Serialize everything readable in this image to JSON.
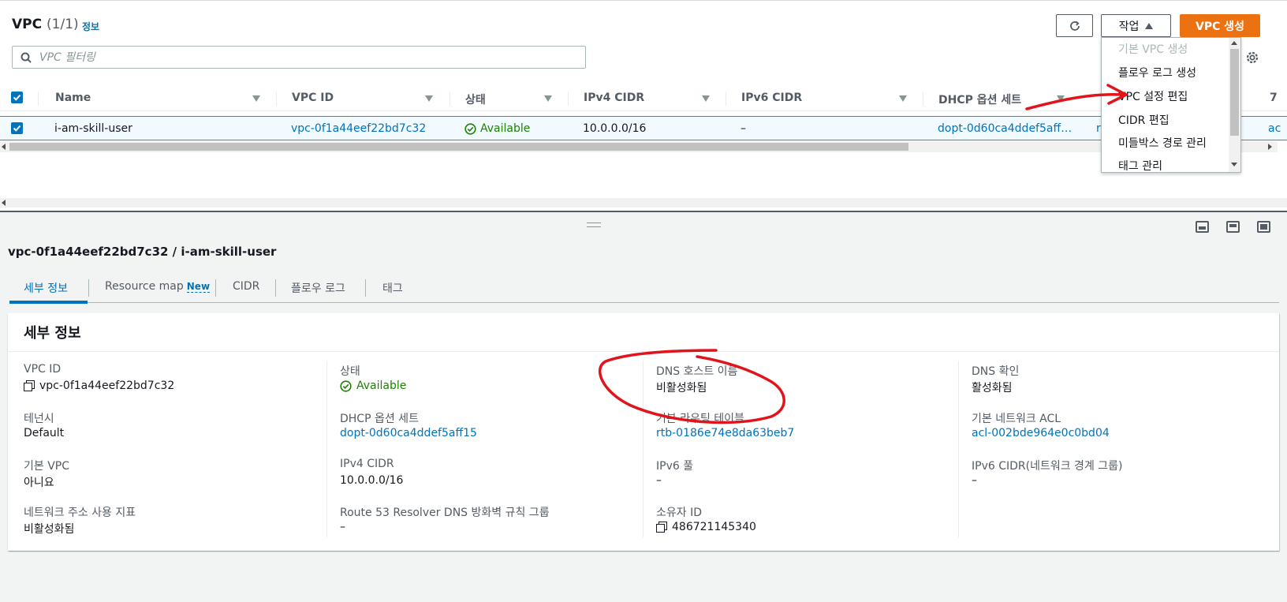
{
  "header": {
    "title": "VPC",
    "count": "(1/1)",
    "info_link": "정보",
    "actions_label": "작업",
    "create_label": "VPC 생성"
  },
  "search": {
    "placeholder": "VPC 필터링"
  },
  "table": {
    "columns": [
      "Name",
      "VPC ID",
      "상태",
      "IPv4 CIDR",
      "IPv6 CIDR",
      "DHCP 옵션 세트"
    ],
    "rows": [
      {
        "name": "i-am-skill-user",
        "vpc_id": "vpc-0f1a44eef22bd7c32",
        "status": "Available",
        "ipv4": "10.0.0.0/16",
        "ipv6": "–",
        "dhcp": "dopt-0d60ca4ddef5aff…",
        "partial_r": "r",
        "partial_a": "ac"
      }
    ],
    "partial_header": "7"
  },
  "dropdown": {
    "items": [
      "기본 VPC 생성",
      "플로우 로그 생성",
      "VPC 설정 편집",
      "CIDR 편집",
      "미들박스 경로 관리",
      "태그 관리"
    ]
  },
  "detail": {
    "title": "vpc-0f1a44eef22bd7c32 / i-am-skill-user",
    "tabs": [
      {
        "label": "세부 정보"
      },
      {
        "label": "Resource map",
        "badge": "New"
      },
      {
        "label": "CIDR"
      },
      {
        "label": "플로우 로그"
      },
      {
        "label": "태그"
      }
    ],
    "card_title": "세부 정보",
    "fields": {
      "vpc_id": {
        "label": "VPC ID",
        "value": "vpc-0f1a44eef22bd7c32"
      },
      "tenancy": {
        "label": "테넌시",
        "value": "Default"
      },
      "default_vpc": {
        "label": "기본 VPC",
        "value": "아니요"
      },
      "net_addr_metric": {
        "label": "네트워크 주소 사용 지표",
        "value": "비활성화됨"
      },
      "state": {
        "label": "상태",
        "value": "Available"
      },
      "dhcp": {
        "label": "DHCP 옵션 세트",
        "value": "dopt-0d60ca4ddef5aff15"
      },
      "ipv4": {
        "label": "IPv4 CIDR",
        "value": "10.0.0.0/16"
      },
      "r53": {
        "label": "Route 53 Resolver DNS 방화벽 규칙 그룹",
        "value": "–"
      },
      "dns_hostnames": {
        "label": "DNS 호스트 이름",
        "value": "비활성화됨"
      },
      "main_rt": {
        "label": "기본 라우팅 테이블",
        "value": "rtb-0186e74e8da63beb7"
      },
      "ipv6_pool": {
        "label": "IPv6 풀",
        "value": "–"
      },
      "owner": {
        "label": "소유자 ID",
        "value": "486721145340"
      },
      "dns_resolution": {
        "label": "DNS 확인",
        "value": "활성화됨"
      },
      "main_acl": {
        "label": "기본 네트워크 ACL",
        "value": "acl-002bde964e0c0bd04"
      },
      "ipv6_cidr_nbg": {
        "label": "IPv6 CIDR(네트워크 경계 그룹)",
        "value": "–"
      }
    }
  },
  "colors": {
    "accent": "#0073bb",
    "primary_button": "#ec7211",
    "available": "#1d8102",
    "annotation": "#e0141a"
  }
}
